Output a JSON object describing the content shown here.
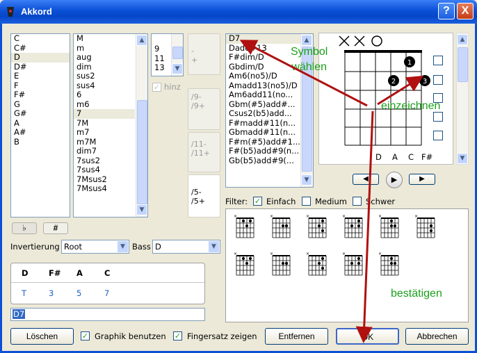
{
  "window": {
    "title": "Akkord",
    "help": "?",
    "close": "X"
  },
  "roots": [
    "C",
    "C#",
    "D",
    "D#",
    "E",
    "F",
    "F#",
    "G",
    "G#",
    "A",
    "A#",
    "B"
  ],
  "selected_root_index": 2,
  "types": [
    "M",
    "m",
    "aug",
    "dim",
    "sus2",
    "sus4",
    "6",
    "m6",
    "7",
    "7M",
    "m7",
    "m7M",
    "dim7",
    "7sus2",
    "7sus4",
    "7Msus2",
    "7Msus4"
  ],
  "selected_type_index": 8,
  "extensions": [
    "9",
    "11",
    "13"
  ],
  "hinz_label": "hinz",
  "tiles": {
    "t1": [
      "-",
      "+"
    ],
    "t2": [
      "/9-",
      "/9+"
    ],
    "t3": [
      "/11-",
      "/11+"
    ],
    "t4": [
      "/5-",
      "/5+"
    ]
  },
  "flat_label": "♭",
  "sharp_label": "#",
  "invert_label": "Invertierung",
  "invert_value": "Root",
  "bass_label": "Bass",
  "bass_value": "D",
  "notes_header": [
    "D",
    "F#",
    "A",
    "C"
  ],
  "notes_intervals": [
    "T",
    "3",
    "5",
    "7"
  ],
  "chord_field": "D7",
  "symbols": [
    "D7",
    "Dadd#13",
    "F#dim/D",
    "Gbdim/D",
    "Am6(no5)/D",
    "Amadd13(no5)/D",
    "Am6add11(no...",
    "Gbm(#5)add#...",
    "Csus2(b5)add...",
    "F#madd#11(n...",
    "Gbmadd#11(n...",
    "F#m(#5)add#1...",
    "F#(b5)add#9(n...",
    "Gb(b5)add#9(..."
  ],
  "diagram": {
    "top_markers": [
      "×",
      "×",
      "○"
    ],
    "string_labels": [
      "D",
      "A",
      "C",
      "F#"
    ],
    "fingers": [
      "1",
      "2",
      "3"
    ]
  },
  "filter_label": "Filter:",
  "filter_options": [
    {
      "label": "Einfach",
      "checked": true
    },
    {
      "label": "Medium",
      "checked": false
    },
    {
      "label": "Schwer",
      "checked": false
    }
  ],
  "annotations": {
    "symbol": "Symbol\nwählen",
    "einzeichnen": "einzeichnen",
    "bestaetigen": "bestätigen"
  },
  "buttons": {
    "loeschen": "Löschen",
    "graphik": "Graphik benutzen",
    "fingersatz": "Fingersatz zeigen",
    "entfernen": "Entfernen",
    "ok": "OK",
    "abbrechen": "Abbrechen"
  },
  "colors": {
    "title_blue": "#0a4fd6",
    "annotation_green": "#1aa01a",
    "arrow_red": "#b01010",
    "interval_blue": "#1f5fbf"
  }
}
